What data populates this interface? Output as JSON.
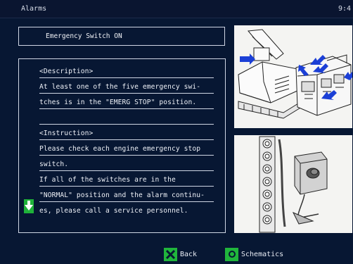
{
  "header": {
    "title": "Alarms",
    "clock": "9:4"
  },
  "alarm": {
    "title": "Emergency Switch ON"
  },
  "details": {
    "lines": [
      "<Description>",
      "At least one of the five emergency swi-",
      "tches is in the \"EMERG STOP\" position.",
      "",
      "<Instruction>",
      "Please check each engine emergency stop",
      "switch.",
      "If all of the switches are in the",
      "\"NORMAL\" position and the alarm continu-",
      "es, please call a service personnel."
    ]
  },
  "footer": {
    "back_label": "Back",
    "schematics_label": "Schematics"
  },
  "colors": {
    "background": "#071733",
    "accent": "#20b53c",
    "arrow": "#1b3fd6"
  },
  "icons": {
    "scroll": "arrow-down-icon",
    "back": "x-icon",
    "schematics": "circle-icon"
  }
}
